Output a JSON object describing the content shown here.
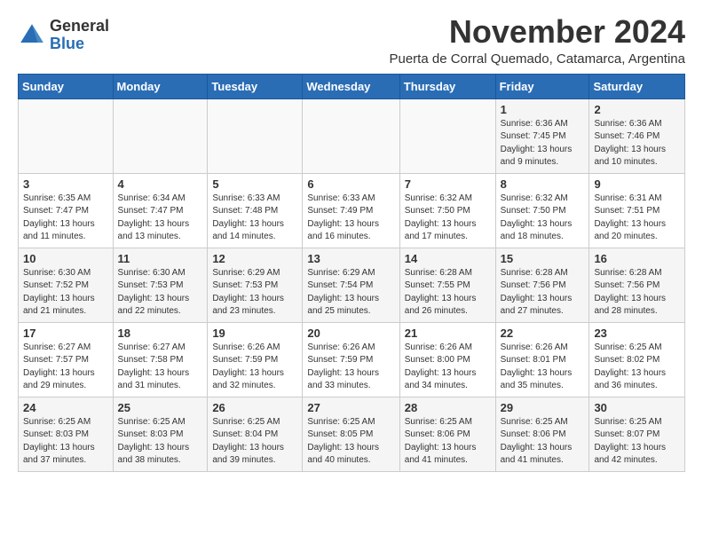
{
  "logo": {
    "general": "General",
    "blue": "Blue"
  },
  "header": {
    "month": "November 2024",
    "location": "Puerta de Corral Quemado, Catamarca, Argentina"
  },
  "weekdays": [
    "Sunday",
    "Monday",
    "Tuesday",
    "Wednesday",
    "Thursday",
    "Friday",
    "Saturday"
  ],
  "weeks": [
    [
      {
        "day": "",
        "info": ""
      },
      {
        "day": "",
        "info": ""
      },
      {
        "day": "",
        "info": ""
      },
      {
        "day": "",
        "info": ""
      },
      {
        "day": "",
        "info": ""
      },
      {
        "day": "1",
        "info": "Sunrise: 6:36 AM\nSunset: 7:45 PM\nDaylight: 13 hours and 9 minutes."
      },
      {
        "day": "2",
        "info": "Sunrise: 6:36 AM\nSunset: 7:46 PM\nDaylight: 13 hours and 10 minutes."
      }
    ],
    [
      {
        "day": "3",
        "info": "Sunrise: 6:35 AM\nSunset: 7:47 PM\nDaylight: 13 hours and 11 minutes."
      },
      {
        "day": "4",
        "info": "Sunrise: 6:34 AM\nSunset: 7:47 PM\nDaylight: 13 hours and 13 minutes."
      },
      {
        "day": "5",
        "info": "Sunrise: 6:33 AM\nSunset: 7:48 PM\nDaylight: 13 hours and 14 minutes."
      },
      {
        "day": "6",
        "info": "Sunrise: 6:33 AM\nSunset: 7:49 PM\nDaylight: 13 hours and 16 minutes."
      },
      {
        "day": "7",
        "info": "Sunrise: 6:32 AM\nSunset: 7:50 PM\nDaylight: 13 hours and 17 minutes."
      },
      {
        "day": "8",
        "info": "Sunrise: 6:32 AM\nSunset: 7:50 PM\nDaylight: 13 hours and 18 minutes."
      },
      {
        "day": "9",
        "info": "Sunrise: 6:31 AM\nSunset: 7:51 PM\nDaylight: 13 hours and 20 minutes."
      }
    ],
    [
      {
        "day": "10",
        "info": "Sunrise: 6:30 AM\nSunset: 7:52 PM\nDaylight: 13 hours and 21 minutes."
      },
      {
        "day": "11",
        "info": "Sunrise: 6:30 AM\nSunset: 7:53 PM\nDaylight: 13 hours and 22 minutes."
      },
      {
        "day": "12",
        "info": "Sunrise: 6:29 AM\nSunset: 7:53 PM\nDaylight: 13 hours and 23 minutes."
      },
      {
        "day": "13",
        "info": "Sunrise: 6:29 AM\nSunset: 7:54 PM\nDaylight: 13 hours and 25 minutes."
      },
      {
        "day": "14",
        "info": "Sunrise: 6:28 AM\nSunset: 7:55 PM\nDaylight: 13 hours and 26 minutes."
      },
      {
        "day": "15",
        "info": "Sunrise: 6:28 AM\nSunset: 7:56 PM\nDaylight: 13 hours and 27 minutes."
      },
      {
        "day": "16",
        "info": "Sunrise: 6:28 AM\nSunset: 7:56 PM\nDaylight: 13 hours and 28 minutes."
      }
    ],
    [
      {
        "day": "17",
        "info": "Sunrise: 6:27 AM\nSunset: 7:57 PM\nDaylight: 13 hours and 29 minutes."
      },
      {
        "day": "18",
        "info": "Sunrise: 6:27 AM\nSunset: 7:58 PM\nDaylight: 13 hours and 31 minutes."
      },
      {
        "day": "19",
        "info": "Sunrise: 6:26 AM\nSunset: 7:59 PM\nDaylight: 13 hours and 32 minutes."
      },
      {
        "day": "20",
        "info": "Sunrise: 6:26 AM\nSunset: 7:59 PM\nDaylight: 13 hours and 33 minutes."
      },
      {
        "day": "21",
        "info": "Sunrise: 6:26 AM\nSunset: 8:00 PM\nDaylight: 13 hours and 34 minutes."
      },
      {
        "day": "22",
        "info": "Sunrise: 6:26 AM\nSunset: 8:01 PM\nDaylight: 13 hours and 35 minutes."
      },
      {
        "day": "23",
        "info": "Sunrise: 6:25 AM\nSunset: 8:02 PM\nDaylight: 13 hours and 36 minutes."
      }
    ],
    [
      {
        "day": "24",
        "info": "Sunrise: 6:25 AM\nSunset: 8:03 PM\nDaylight: 13 hours and 37 minutes."
      },
      {
        "day": "25",
        "info": "Sunrise: 6:25 AM\nSunset: 8:03 PM\nDaylight: 13 hours and 38 minutes."
      },
      {
        "day": "26",
        "info": "Sunrise: 6:25 AM\nSunset: 8:04 PM\nDaylight: 13 hours and 39 minutes."
      },
      {
        "day": "27",
        "info": "Sunrise: 6:25 AM\nSunset: 8:05 PM\nDaylight: 13 hours and 40 minutes."
      },
      {
        "day": "28",
        "info": "Sunrise: 6:25 AM\nSunset: 8:06 PM\nDaylight: 13 hours and 41 minutes."
      },
      {
        "day": "29",
        "info": "Sunrise: 6:25 AM\nSunset: 8:06 PM\nDaylight: 13 hours and 41 minutes."
      },
      {
        "day": "30",
        "info": "Sunrise: 6:25 AM\nSunset: 8:07 PM\nDaylight: 13 hours and 42 minutes."
      }
    ]
  ]
}
